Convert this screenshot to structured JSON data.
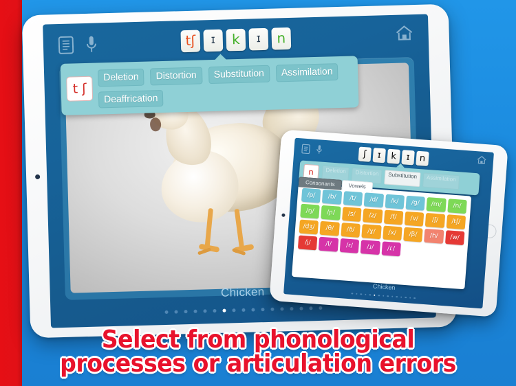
{
  "theme": {
    "bg_blue": "#1b8fe0",
    "stripe_red": "#e60f15",
    "screen_blue": "#16639a",
    "popup_teal": "#8fd0d6",
    "banner_red": "#e8122c"
  },
  "banner": {
    "line1": "Select from phonological",
    "line2": "processes or articulation errors"
  },
  "big_tablet": {
    "toolbar": {
      "doc_icon": "document-icon",
      "mic_icon": "microphone-icon",
      "home_icon": "home-icon"
    },
    "word_tiles": [
      {
        "glyph": "tʃ",
        "color": "orange"
      },
      {
        "glyph": "ɪ",
        "color": "dark"
      },
      {
        "glyph": "k",
        "color": "green"
      },
      {
        "glyph": "ɪ",
        "color": "dark"
      },
      {
        "glyph": "n",
        "color": "green"
      }
    ],
    "popup": {
      "chip": "t ʃ",
      "options": [
        {
          "label": "Deletion",
          "state": "normal"
        },
        {
          "label": "Distortion",
          "state": "normal"
        },
        {
          "label": "Substitution",
          "state": "normal"
        },
        {
          "label": "Assimilation",
          "state": "normal"
        },
        {
          "label": "Deaffrication",
          "state": "normal"
        }
      ]
    },
    "caption": "Chicken",
    "page_dots": {
      "count": 17,
      "active_index": 6
    },
    "photo_alt": "chicken-photo"
  },
  "small_tablet": {
    "toolbar": {
      "doc_icon": "document-icon",
      "mic_icon": "microphone-icon",
      "home_icon": "home-icon"
    },
    "word_tiles": [
      {
        "glyph": "ʃ",
        "color": "orange"
      },
      {
        "glyph": "ɪ",
        "color": "dark"
      },
      {
        "glyph": "k",
        "color": "green"
      },
      {
        "glyph": "ɪ",
        "color": "dark"
      },
      {
        "glyph": "n",
        "color": "red"
      }
    ],
    "popup": {
      "chip": "n",
      "options": [
        {
          "label": "Deletion",
          "state": "dim"
        },
        {
          "label": "Distortion",
          "state": "dim"
        },
        {
          "label": "Substitution",
          "state": "selected"
        },
        {
          "label": "Assimilation",
          "state": "dim"
        }
      ]
    },
    "tabs": [
      {
        "label": "Consonants",
        "active": false
      },
      {
        "label": "Vowels",
        "active": true
      }
    ],
    "phonemes": [
      {
        "label": "/p/",
        "color": "#6fc4d8"
      },
      {
        "label": "/b/",
        "color": "#6fc4d8"
      },
      {
        "label": "/t/",
        "color": "#6fc4d8"
      },
      {
        "label": "/d/",
        "color": "#6fc4d8"
      },
      {
        "label": "/k/",
        "color": "#6fc4d8"
      },
      {
        "label": "/g/",
        "color": "#6fc4d8"
      },
      {
        "label": "/m/",
        "color": "#7ed957"
      },
      {
        "label": "/n/",
        "color": "#7ed957"
      },
      {
        "label": "/ŋ/",
        "color": "#7ed957"
      },
      {
        "label": "/ɲ/",
        "color": "#7ed957"
      },
      {
        "label": "/s/",
        "color": "#f5a623"
      },
      {
        "label": "/z/",
        "color": "#f5a623"
      },
      {
        "label": "/f/",
        "color": "#f5a623"
      },
      {
        "label": "/v/",
        "color": "#f5a623"
      },
      {
        "label": "/ʃ/",
        "color": "#f5a623"
      },
      {
        "label": "/tʃ/",
        "color": "#f5a623"
      },
      {
        "label": "/dʒ/",
        "color": "#f5a623"
      },
      {
        "label": "/θ/",
        "color": "#f5a623"
      },
      {
        "label": "/ð/",
        "color": "#f5a623"
      },
      {
        "label": "/ɣ/",
        "color": "#f5a623"
      },
      {
        "label": "/x/",
        "color": "#f5a623"
      },
      {
        "label": "/β/",
        "color": "#f5a623"
      },
      {
        "label": "/h/",
        "color": "#f2836f"
      },
      {
        "label": "/w/",
        "color": "#e53935"
      },
      {
        "label": "/j/",
        "color": "#e53935"
      },
      {
        "label": "/l/",
        "color": "#d633a8"
      },
      {
        "label": "/r/",
        "color": "#d633a8"
      },
      {
        "label": "/ɹ/",
        "color": "#d633a8"
      },
      {
        "label": "/ɾ/",
        "color": "#d633a8"
      }
    ],
    "caption": "Chicken",
    "page_dots": {
      "count": 15,
      "active_index": 5
    }
  }
}
